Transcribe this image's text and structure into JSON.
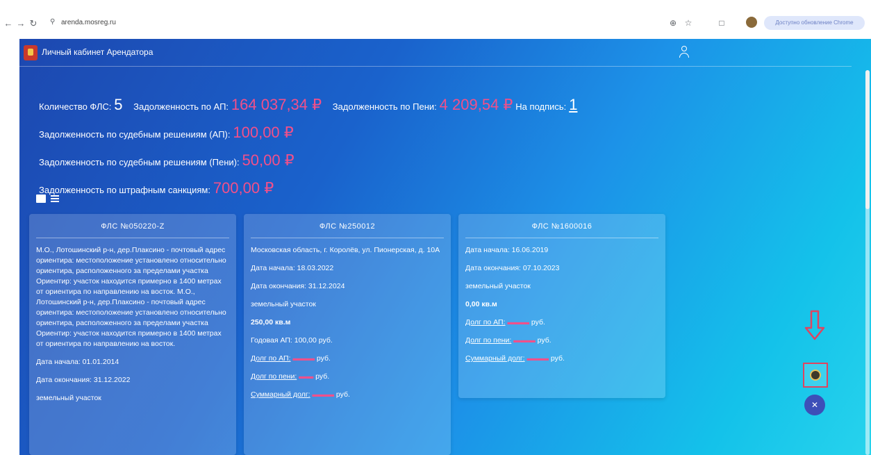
{
  "browser": {
    "url": "arenda.mosreg.ru",
    "update_label": "Доступно обновление Chrome"
  },
  "app": {
    "title": "Личный кабинет Арендатора"
  },
  "summary": {
    "fls_count_label": "Количество ФЛС:",
    "fls_count": "5",
    "debt_ap_label": "Задолженность по АП:",
    "debt_ap_value": "164 037,34 ₽",
    "debt_peni_label": "Задолженность по Пени:",
    "debt_peni_value": "4 209,54 ₽",
    "to_sign_label": "На подпись:",
    "to_sign_value": "1",
    "court_ap_label": "Задолженность по судебным решениям (АП):",
    "court_ap_value": "100,00 ₽",
    "court_peni_label": "Задолженность по судебным решениям (Пени):",
    "court_peni_value": "50,00 ₽",
    "penalty_label": "Задолженность по штрафным санкциям:",
    "penalty_value": "700,00 ₽"
  },
  "cards": [
    {
      "title": "ФЛС №050220-Z",
      "address": "М.О., Лотошинский р-н, дер.Плаксино - почтовый адрес ориентира: местоположение установлено относительно ориентира, расположенного за пределами участка Ориентир: участок находится примерно в 1400 метрах от ориентира по направлению на восток. М.О., Лотошинский р-н, дер.Плаксино - почтовый адрес ориентира: местоположение установлено относительно ориентира, расположенного за пределами участка Ориентир: участок находится примерно в 1400 метрах от ориентира по направлению на восток.",
      "start": "Дата начала: 01.01.2014",
      "end": "Дата окончания: 31.12.2022",
      "type": "земельный участок"
    },
    {
      "title": "ФЛС №250012",
      "address": "Московская область, г. Королёв, ул. Пионерская, д. 10А",
      "start": "Дата начала: 18.03.2022",
      "end": "Дата окончания: 31.12.2024",
      "type": "земельный участок",
      "area": "250,00 кв.м",
      "annual": "Годовая АП: 100,00 руб.",
      "debt_ap": "Долг по АП:",
      "debt_peni": "Долг по пени:",
      "total": "Суммарный долг:",
      "currency": "руб."
    },
    {
      "title": "ФЛС №1600016",
      "start": "Дата начала: 16.06.2019",
      "end": "Дата окончания: 07.10.2023",
      "type": "земельный участок",
      "area": "0,00 кв.м",
      "debt_ap": "Долг по АП:",
      "debt_peni": "Долг по пени:",
      "total": "Суммарный долг:",
      "currency": "руб."
    }
  ]
}
